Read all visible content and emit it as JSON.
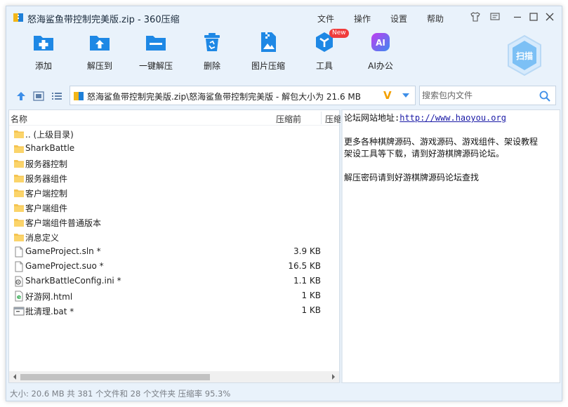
{
  "window": {
    "title": "怒海鲨鱼带控制完美版.zip - 360压缩",
    "menu": [
      "文件",
      "操作",
      "设置",
      "帮助"
    ]
  },
  "toolbar": {
    "items": [
      {
        "label": "添加",
        "icon": "add-icon"
      },
      {
        "label": "解压到",
        "icon": "extract-to-icon"
      },
      {
        "label": "一键解压",
        "icon": "one-click-extract-icon"
      },
      {
        "label": "删除",
        "icon": "delete-icon"
      },
      {
        "label": "图片压缩",
        "icon": "image-compress-icon"
      },
      {
        "label": "工具",
        "icon": "tools-icon",
        "badge": "New"
      },
      {
        "label": "AI办公",
        "icon": "ai-office-icon",
        "icon_text": "AI"
      }
    ],
    "scan_label": "扫描"
  },
  "address": {
    "path": "怒海鲨鱼带控制完美版.zip\\怒海鲨鱼带控制完美版 - 解包大小为 21.6 MB",
    "v_label": "V"
  },
  "search": {
    "placeholder": "搜索包内文件"
  },
  "file_list": {
    "columns": {
      "name": "名称",
      "before": "压缩前",
      "after": "压缩后"
    },
    "rows": [
      {
        "name": ".. (上级目录)",
        "size": "",
        "type": "folder"
      },
      {
        "name": "SharkBattle",
        "size": "",
        "type": "folder"
      },
      {
        "name": "服务器控制",
        "size": "",
        "type": "folder"
      },
      {
        "name": "服务器组件",
        "size": "",
        "type": "folder"
      },
      {
        "name": "客户端控制",
        "size": "",
        "type": "folder"
      },
      {
        "name": "客户端组件",
        "size": "",
        "type": "folder"
      },
      {
        "name": "客户端组件普通版本",
        "size": "",
        "type": "folder"
      },
      {
        "name": "消息定义",
        "size": "",
        "type": "folder"
      },
      {
        "name": "GameProject.sln *",
        "size": "3.9 KB",
        "type": "file"
      },
      {
        "name": "GameProject.suo *",
        "size": "16.5 KB",
        "type": "file"
      },
      {
        "name": "SharkBattleConfig.ini *",
        "size": "1.1 KB",
        "type": "ini"
      },
      {
        "name": "好游网.html",
        "size": "1 KB",
        "type": "html"
      },
      {
        "name": "批清理.bat *",
        "size": "1 KB",
        "type": "bat"
      }
    ]
  },
  "comment": {
    "line1_label": "论坛网站地址:",
    "line1_link": "http://www.haoyou.org",
    "line2": "更多各种棋牌源码、游戏源码、游戏组件、架设教程",
    "line3": "架设工具等下载，请到好游棋牌源码论坛。",
    "line4": "解压密码请到好游棋牌源码论坛查找"
  },
  "status": {
    "text": "大小: 20.6 MB 共 381 个文件和 28 个文件夹 压缩率 95.3%"
  },
  "colors": {
    "accent": "#1e88e5",
    "folder": "#f5c451",
    "background": "#e9f2fb"
  }
}
